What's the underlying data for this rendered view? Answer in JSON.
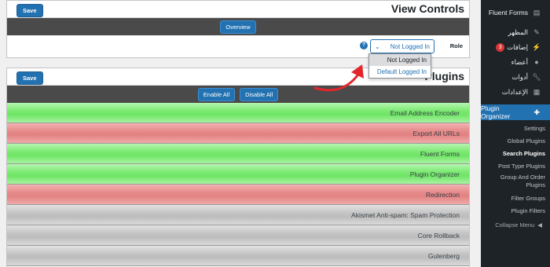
{
  "view_controls": {
    "title": "View Controls",
    "save_label": "Save",
    "overview_label": "Overview",
    "role_label": "Role",
    "help": "?",
    "role_value": "Not Logged In",
    "role_options": [
      "Not Logged In",
      "Default Logged In"
    ]
  },
  "plugins": {
    "title": "Plugins",
    "save_label": "Save",
    "enable_all_label": "Enable All",
    "disable_all_label": "Disable All",
    "rows": [
      {
        "name": "Email Address Encoder",
        "status": "green"
      },
      {
        "name": "Export All URLs",
        "status": "red"
      },
      {
        "name": "Fluent Forms",
        "status": "green"
      },
      {
        "name": "Plugin Organizer",
        "status": "green"
      },
      {
        "name": "Redirection",
        "status": "red"
      },
      {
        "name": "Akismet Anti-spam: Spam Protection",
        "status": "gray"
      },
      {
        "name": "Core Rollback",
        "status": "gray"
      },
      {
        "name": "Gutenberg",
        "status": "gray"
      }
    ]
  },
  "sidebar": {
    "items": [
      {
        "label": "Fluent Forms",
        "icon": "form-icon"
      },
      {
        "label": "المظهر",
        "icon": "brush-icon"
      },
      {
        "label": "إضافات",
        "icon": "plugin-icon",
        "badge": "3"
      },
      {
        "label": "أعضاء",
        "icon": "user-icon"
      },
      {
        "label": "أدوات",
        "icon": "wrench-icon"
      },
      {
        "label": "الإعدادات",
        "icon": "settings-icon"
      }
    ],
    "active": {
      "label": "Plugin Organizer",
      "icon": "puzzle-icon"
    },
    "submenu": [
      "Settings",
      "Global Plugins",
      "Search Plugins",
      "Post Type Plugins",
      "Group And Order Plugins",
      "Filter Groups",
      "Plugin Filters"
    ],
    "current_submenu": "Search Plugins",
    "collapse_label": "Collapse Menu"
  },
  "colors": {
    "accent": "#2271b1",
    "sidebar_bg": "#1d2327",
    "enabled": "#6ee565",
    "disabled": "#e28282",
    "inactive": "#c4c4c4",
    "annotation_arrow": "#e3262b"
  }
}
